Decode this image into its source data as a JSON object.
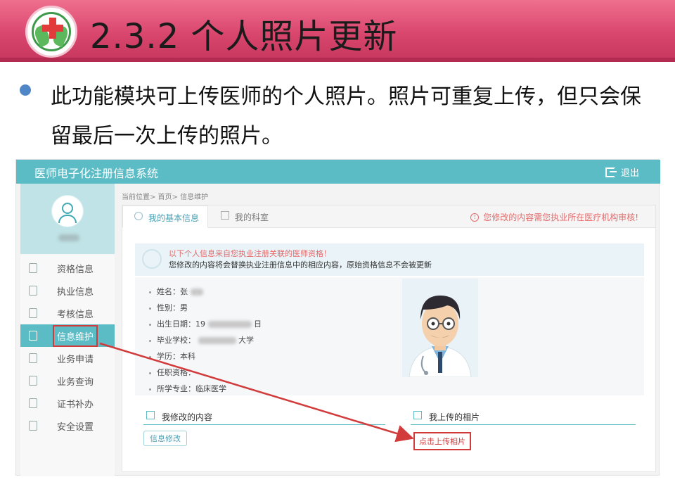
{
  "slide": {
    "title": "2.3.2 个人照片更新",
    "body_text": "此功能模块可上传医师的个人照片。照片可重复上传，但只会保留最后一次上传的照片。"
  },
  "app": {
    "title": "医师电子化注册信息系统",
    "logout_label": "退出",
    "breadcrumb": "当前位置> 首页> 信息维护",
    "sidebar": {
      "items": [
        {
          "label": "资格信息"
        },
        {
          "label": "执业信息"
        },
        {
          "label": "考核信息"
        },
        {
          "label": "信息维护"
        },
        {
          "label": "业务申请"
        },
        {
          "label": "业务查询"
        },
        {
          "label": "证书补办"
        },
        {
          "label": "安全设置"
        }
      ]
    },
    "tabs": [
      {
        "label": "我的基本信息"
      },
      {
        "label": "我的科室"
      }
    ],
    "notice": "您修改的内容需您执业所在医疗机构审核!",
    "info_line1": "以下个人信息来自您执业注册关联的医师资格！",
    "info_line2": "您修改的内容将会替换执业注册信息中的相应内容，原始资格信息不会被更新",
    "fields": [
      {
        "label": "姓名：张"
      },
      {
        "label": "性别：男"
      },
      {
        "label": "出生日期：19",
        "suffix": "日"
      },
      {
        "label": "毕业学校：",
        "suffix": "大学"
      },
      {
        "label": "学历：本科"
      },
      {
        "label": "任职资格："
      },
      {
        "label": "所学专业：临床医学"
      }
    ],
    "section_modify": "我修改的内容",
    "section_photo": "我上传的相片",
    "btn_modify": "信息修改",
    "btn_upload": "点击上传相片"
  },
  "colors": {
    "header_pink": "#d9466d",
    "teal": "#5bbcc6",
    "highlight_red": "#d23b3b"
  }
}
